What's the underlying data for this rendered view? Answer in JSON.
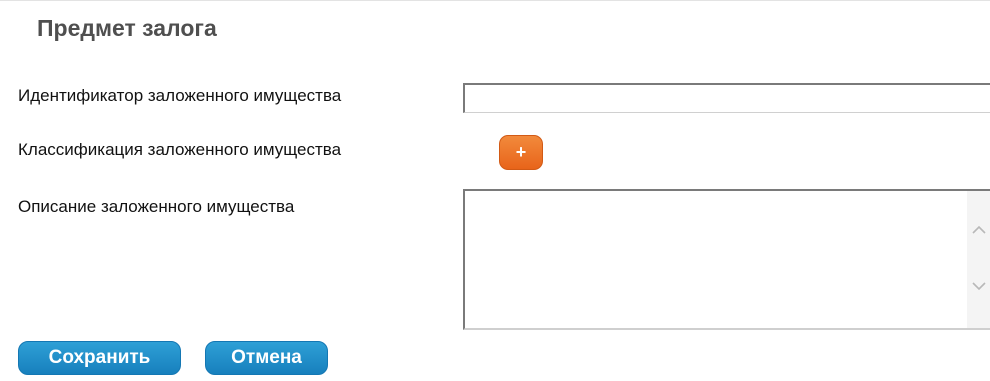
{
  "form": {
    "title": "Предмет залога",
    "fields": {
      "identifier": {
        "label": "Идентификатор заложенного имущества",
        "value": ""
      },
      "classification": {
        "label": "Классификация заложенного имущества",
        "add_button_label": "+",
        "add_button_icon": "plus-icon",
        "add_button_color": "#ec7427"
      },
      "description": {
        "label": "Описание заложенного имущества",
        "value": "",
        "scroll_up_icon": "chevron-up-icon",
        "scroll_down_icon": "chevron-down-icon"
      }
    },
    "actions": {
      "save_label": "Сохранить",
      "cancel_label": "Отмена",
      "button_color": "#1c8bc8"
    }
  }
}
